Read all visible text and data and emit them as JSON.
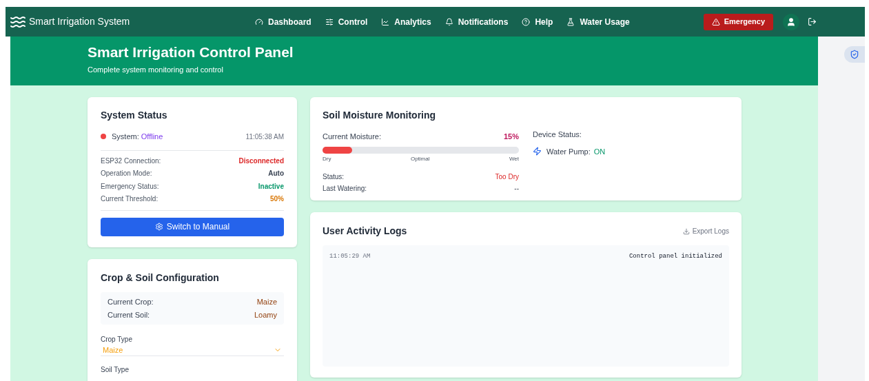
{
  "nav": {
    "brand": "Smart Irrigation System",
    "items": [
      {
        "label": "Dashboard"
      },
      {
        "label": "Control"
      },
      {
        "label": "Analytics"
      },
      {
        "label": "Notifications"
      },
      {
        "label": "Help"
      },
      {
        "label": "Water Usage"
      }
    ],
    "emergency": "Emergency"
  },
  "hero": {
    "title": "Smart Irrigation Control Panel",
    "subtitle": "Complete system monitoring and control"
  },
  "system_status": {
    "title": "System Status",
    "label": "System:",
    "state": "Offline",
    "online": false,
    "time": "11:05:38 AM",
    "rows": [
      {
        "label": "ESP32 Connection:",
        "value": "Disconnected",
        "color": "#dc2626"
      },
      {
        "label": "Operation Mode:",
        "value": "Auto",
        "color": "#374151"
      },
      {
        "label": "Emergency Status:",
        "value": "Inactive",
        "color": "#059669"
      },
      {
        "label": "Current Threshold:",
        "value": "50%",
        "color": "#d97706"
      }
    ],
    "button": "Switch to Manual"
  },
  "crop_soil": {
    "title": "Crop & Soil Configuration",
    "current": [
      {
        "label": "Current Crop:",
        "value": "Maize"
      },
      {
        "label": "Current Soil:",
        "value": "Loamy"
      }
    ],
    "crop_type": {
      "label": "Crop Type",
      "value": "Maize"
    },
    "soil_type": {
      "label": "Soil Type"
    }
  },
  "moisture": {
    "title": "Soil Moisture Monitoring",
    "label": "Current Moisture:",
    "reading": "15%",
    "level": 0.15,
    "scale": [
      "Dry",
      "Optimal",
      "Wet"
    ],
    "status_label": "Status:",
    "status": "Too Dry",
    "last_label": "Last Watering:",
    "last": "--",
    "device_title": "Device Status:",
    "pump_label": "Water Pump:",
    "pump_value": "ON",
    "pump_on": true
  },
  "logs": {
    "title": "User Activity Logs",
    "export": "Export Logs",
    "entries": [
      {
        "time": "11:05:29 AM",
        "message": "Control panel initialized"
      }
    ]
  }
}
